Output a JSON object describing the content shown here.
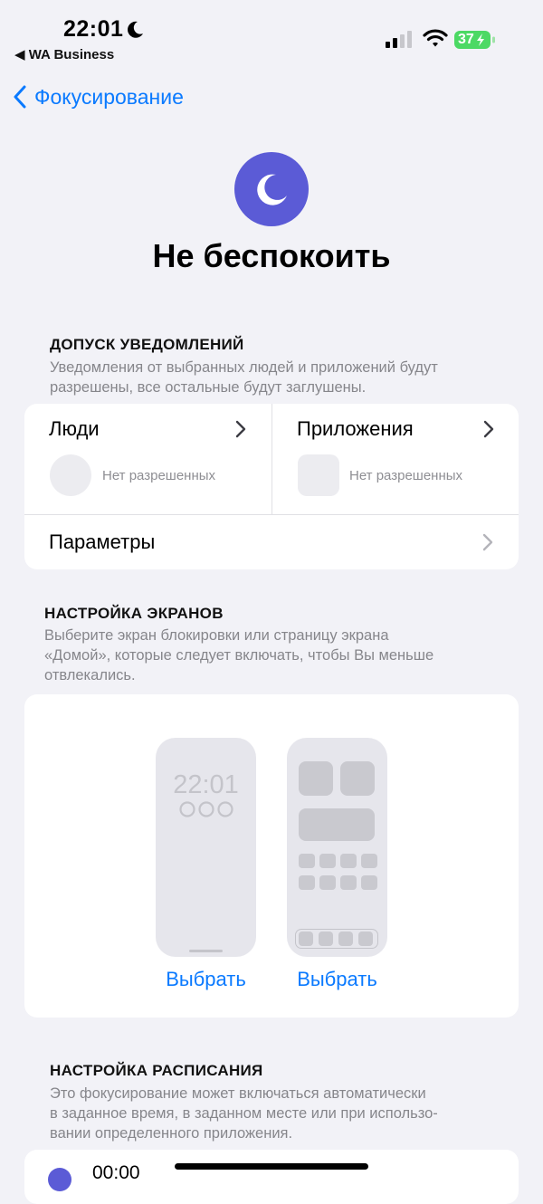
{
  "status_bar": {
    "time": "22:01",
    "back_app": "◀ WA Business",
    "battery": "37"
  },
  "nav": {
    "back_label": "Фокусирование"
  },
  "header": {
    "title": "Не беспокоить"
  },
  "allowed_notifications": {
    "heading": "ДОПУСК УВЕДОМЛЕНИЙ",
    "desc_line1": "Уведомления от выбранных людей и приложений будут",
    "desc_line2": "разрешены, все остальные будут заглушены.",
    "people_label": "Люди",
    "people_none": "Нет разрешенных",
    "apps_label": "Приложения",
    "apps_none": "Нет разрешенных",
    "options_label": "Параметры"
  },
  "screens": {
    "heading": "НАСТРОЙКА ЭКРАНОВ",
    "desc_line1": "Выберите экран блокировки или страницу экрана",
    "desc_line2": "«Домой», которые следует включать, чтобы Вы меньше",
    "desc_line3": "отвлекались.",
    "lock_time": "22:01",
    "lock_choose": "Выбрать",
    "home_choose": "Выбрать"
  },
  "schedule": {
    "heading": "НАСТРОЙКА РАСПИСАНИЯ",
    "desc_line1": "Это фокусирование может включаться автоматически",
    "desc_line2": "в заданное время, в заданном месте или при использо-",
    "desc_line3": "вании определенного приложения.",
    "first_time": "00:00"
  },
  "colors": {
    "accent": "#0a7aff",
    "focus_purple": "#5b5bd6",
    "battery_green": "#4cd964",
    "background": "#f2f2f7"
  }
}
